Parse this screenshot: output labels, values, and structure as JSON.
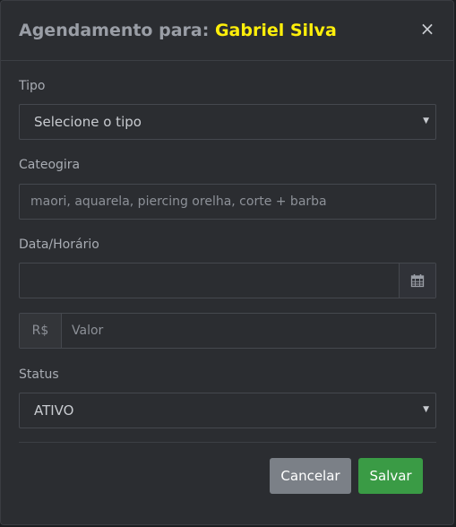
{
  "modal": {
    "title_prefix": "Agendamento para:",
    "title_name": "Gabriel Silva",
    "close_icon": "×"
  },
  "form": {
    "tipo": {
      "label": "Tipo",
      "selected": "Selecione o tipo"
    },
    "categoria": {
      "label": "Cateogira",
      "placeholder": "maori, aquarela, piercing orelha, corte + barba"
    },
    "data_horario": {
      "label": "Data/Horário",
      "value": "",
      "icon": "calendar-icon"
    },
    "valor": {
      "prefix": "R$",
      "placeholder": "Valor"
    },
    "status": {
      "label": "Status",
      "selected": "ATIVO"
    }
  },
  "footer": {
    "cancel_label": "Cancelar",
    "save_label": "Salvar"
  },
  "colors": {
    "background": "#2b2d31",
    "accent_name": "#ffef0a",
    "save_button": "#3a9b45",
    "cancel_button": "#7b8087"
  }
}
